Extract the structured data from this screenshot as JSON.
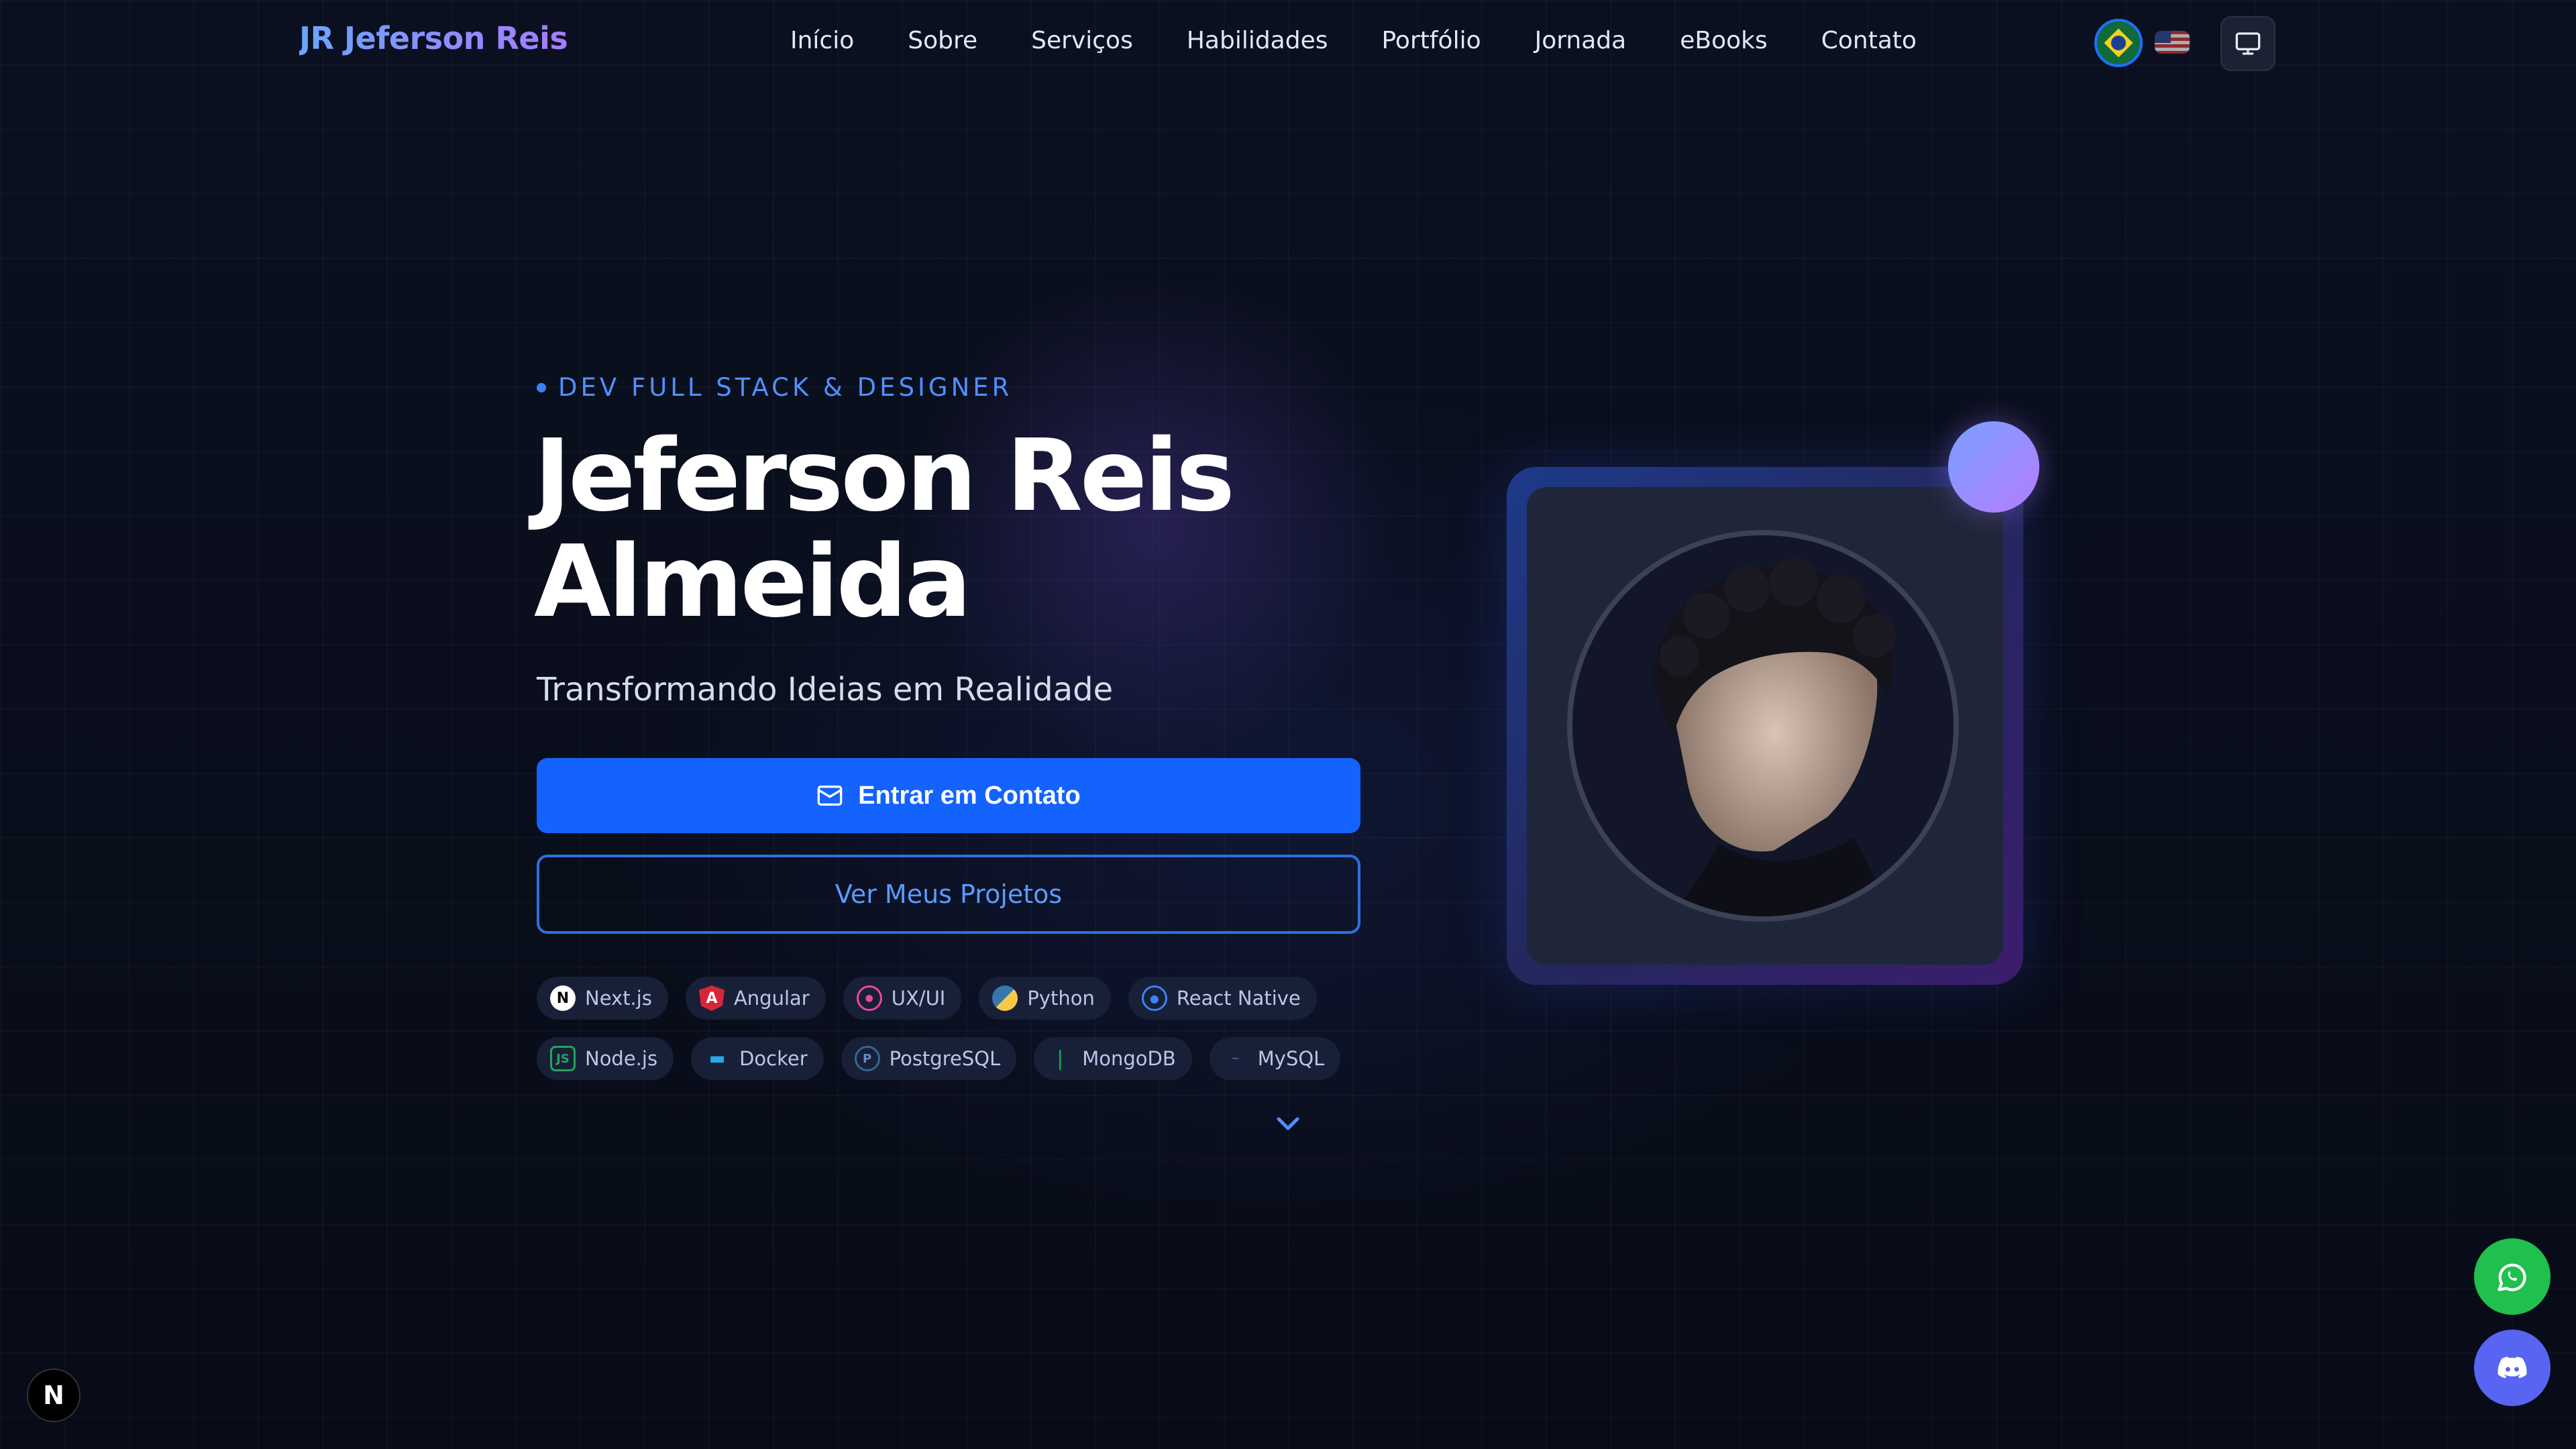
{
  "header": {
    "logo": "JR Jeferson Reis",
    "nav": [
      "Início",
      "Sobre",
      "Serviços",
      "Habilidades",
      "Portfólio",
      "Jornada",
      "eBooks",
      "Contato"
    ],
    "languages": [
      "pt-BR",
      "en-US"
    ],
    "theme_icon": "monitor-icon"
  },
  "hero": {
    "eyebrow": "DEV FULL STACK & DESIGNER",
    "title_line1": "Jeferson Reis",
    "title_line2": "Almeida",
    "subtitle": "Transformando Ideias em Realidade",
    "primary_button": "Entrar em Contato",
    "secondary_button": "Ver Meus Projetos",
    "skills_row1": [
      "Next.js",
      "Angular",
      "UX/UI",
      "Python",
      "React Native"
    ],
    "skills_row2": [
      "Node.js",
      "Docker",
      "PostgreSQL",
      "MongoDB",
      "MySQL"
    ]
  },
  "colors": {
    "background": "#0a0f1e",
    "accent": "#1463ff",
    "whatsapp": "#1fc04d",
    "discord": "#5865f2"
  },
  "floating": {
    "whatsapp_icon": "whatsapp-icon",
    "discord_icon": "discord-icon",
    "nextjs_badge": "N"
  }
}
